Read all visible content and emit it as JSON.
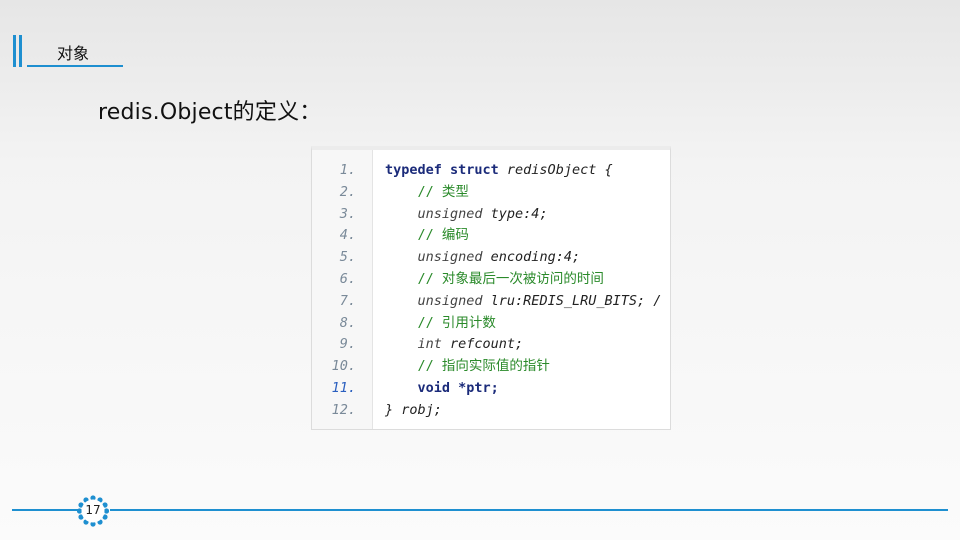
{
  "header": {
    "title": "对象"
  },
  "heading": "redis.Object的定义：",
  "code": {
    "lines": [
      {
        "num": "1.",
        "parts": [
          {
            "t": "typedef struct ",
            "c": "kw"
          },
          {
            "t": "redisObject {",
            "c": "id"
          }
        ]
      },
      {
        "num": "2.",
        "parts": [
          {
            "t": "    // 类型",
            "c": "cm"
          }
        ]
      },
      {
        "num": "3.",
        "parts": [
          {
            "t": "    unsigned ",
            "c": "ty"
          },
          {
            "t": "type:4;",
            "c": "id"
          }
        ]
      },
      {
        "num": "4.",
        "parts": [
          {
            "t": "    // 编码",
            "c": "cm"
          }
        ]
      },
      {
        "num": "5.",
        "parts": [
          {
            "t": "    unsigned ",
            "c": "ty"
          },
          {
            "t": "encoding:4;",
            "c": "id"
          }
        ]
      },
      {
        "num": "6.",
        "parts": [
          {
            "t": "    // 对象最后一次被访问的时间",
            "c": "cm"
          }
        ]
      },
      {
        "num": "7.",
        "parts": [
          {
            "t": "    unsigned ",
            "c": "ty"
          },
          {
            "t": "lru:REDIS_LRU_BITS; /",
            "c": "id"
          }
        ]
      },
      {
        "num": "8.",
        "parts": [
          {
            "t": "    // 引用计数",
            "c": "cm"
          }
        ]
      },
      {
        "num": "9.",
        "parts": [
          {
            "t": "    int ",
            "c": "ty"
          },
          {
            "t": "refcount;",
            "c": "id"
          }
        ]
      },
      {
        "num": "10.",
        "parts": [
          {
            "t": "    // 指向实际值的指针",
            "c": "cm"
          }
        ]
      },
      {
        "num": "11.",
        "parts": [
          {
            "t": "    void ",
            "c": "kw"
          },
          {
            "t": "*ptr;",
            "c": "kw"
          }
        ],
        "highlight": true
      },
      {
        "num": "12.",
        "parts": [
          {
            "t": "} robj;",
            "c": "id"
          }
        ]
      }
    ]
  },
  "footer": {
    "page_number": "17"
  },
  "colors": {
    "accent": "#1e8fd0",
    "comment": "#2a8a2a",
    "keyword": "#1b2b7a"
  }
}
